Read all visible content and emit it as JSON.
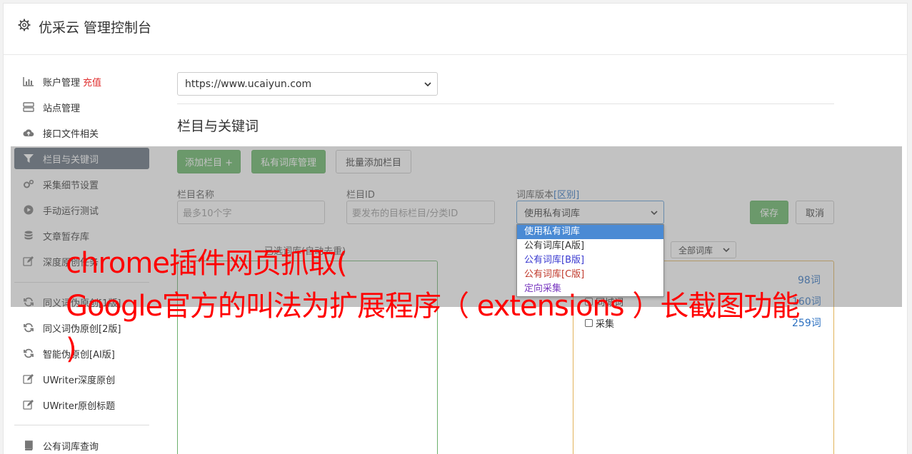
{
  "header": {
    "title": "优采云 管理控制台"
  },
  "sidebar": {
    "items": [
      {
        "label": "账户管理",
        "badge": "充值",
        "icon": "bar-chart-icon"
      },
      {
        "label": "站点管理",
        "icon": "server-icon"
      },
      {
        "label": "接口文件相关",
        "icon": "cloud-upload-icon"
      },
      {
        "label": "栏目与关键词",
        "icon": "filter-icon",
        "active": true
      },
      {
        "label": "采集细节设置",
        "icon": "gears-icon"
      },
      {
        "label": "手动运行测试",
        "icon": "play-circle-icon"
      },
      {
        "label": "文章暂存库",
        "icon": "database-icon"
      },
      {
        "label": "深度原创任务",
        "icon": "edit-icon"
      },
      {
        "label": "同义词伪原创[1版]",
        "icon": "refresh-icon"
      },
      {
        "label": "同义词伪原创[2版]",
        "icon": "refresh-icon"
      },
      {
        "label": "智能伪原创[AI版]",
        "icon": "refresh-icon"
      },
      {
        "label": "UWriter深度原创",
        "icon": "edit-icon"
      },
      {
        "label": "UWriter原创标题",
        "icon": "edit-icon"
      },
      {
        "label": "公有词库查询",
        "icon": "book-icon"
      }
    ]
  },
  "main": {
    "site_select": "https://www.ucaiyun.com",
    "section_title": "栏目与关键词",
    "buttons": {
      "add_column": "添加栏目 +",
      "private_lib": "私有词库管理",
      "batch_add": "批量添加栏目",
      "save": "保存",
      "cancel": "取消"
    },
    "form": {
      "column_name_label": "栏目名称",
      "column_name_placeholder": "最多10个字",
      "column_id_label": "栏目ID",
      "column_id_placeholder": "要发布的目标栏目/分类ID",
      "lib_version_label": "词库版本",
      "lib_version_link": "[区别]",
      "lib_version_value": "使用私有词库"
    },
    "dropdown_options": [
      {
        "label": "使用私有词库",
        "color": "#ffffff",
        "selected": true
      },
      {
        "label": "公有词库[A版]",
        "color": "#333333"
      },
      {
        "label": "公有词库[B版]",
        "color": "#3a3ad0"
      },
      {
        "label": "公有词库[C版]",
        "color": "#c0392b"
      },
      {
        "label": "定向采集",
        "color": "#7a3ac0"
      }
    ],
    "left_panel": {
      "title": "已选词库(自动去重)"
    },
    "right_panel": {
      "filter_value": "全部词库",
      "rows": [
        {
          "label": "",
          "count": "98词"
        },
        {
          "label": "同城词",
          "count": "160词"
        },
        {
          "label": "采集",
          "count": "259词"
        }
      ]
    }
  },
  "watermark": {
    "line1": "chrome插件网页抓取(",
    "line2": "Google官方的叫法为扩展程序（ extensions ）长截图功能",
    "line3": ")"
  }
}
